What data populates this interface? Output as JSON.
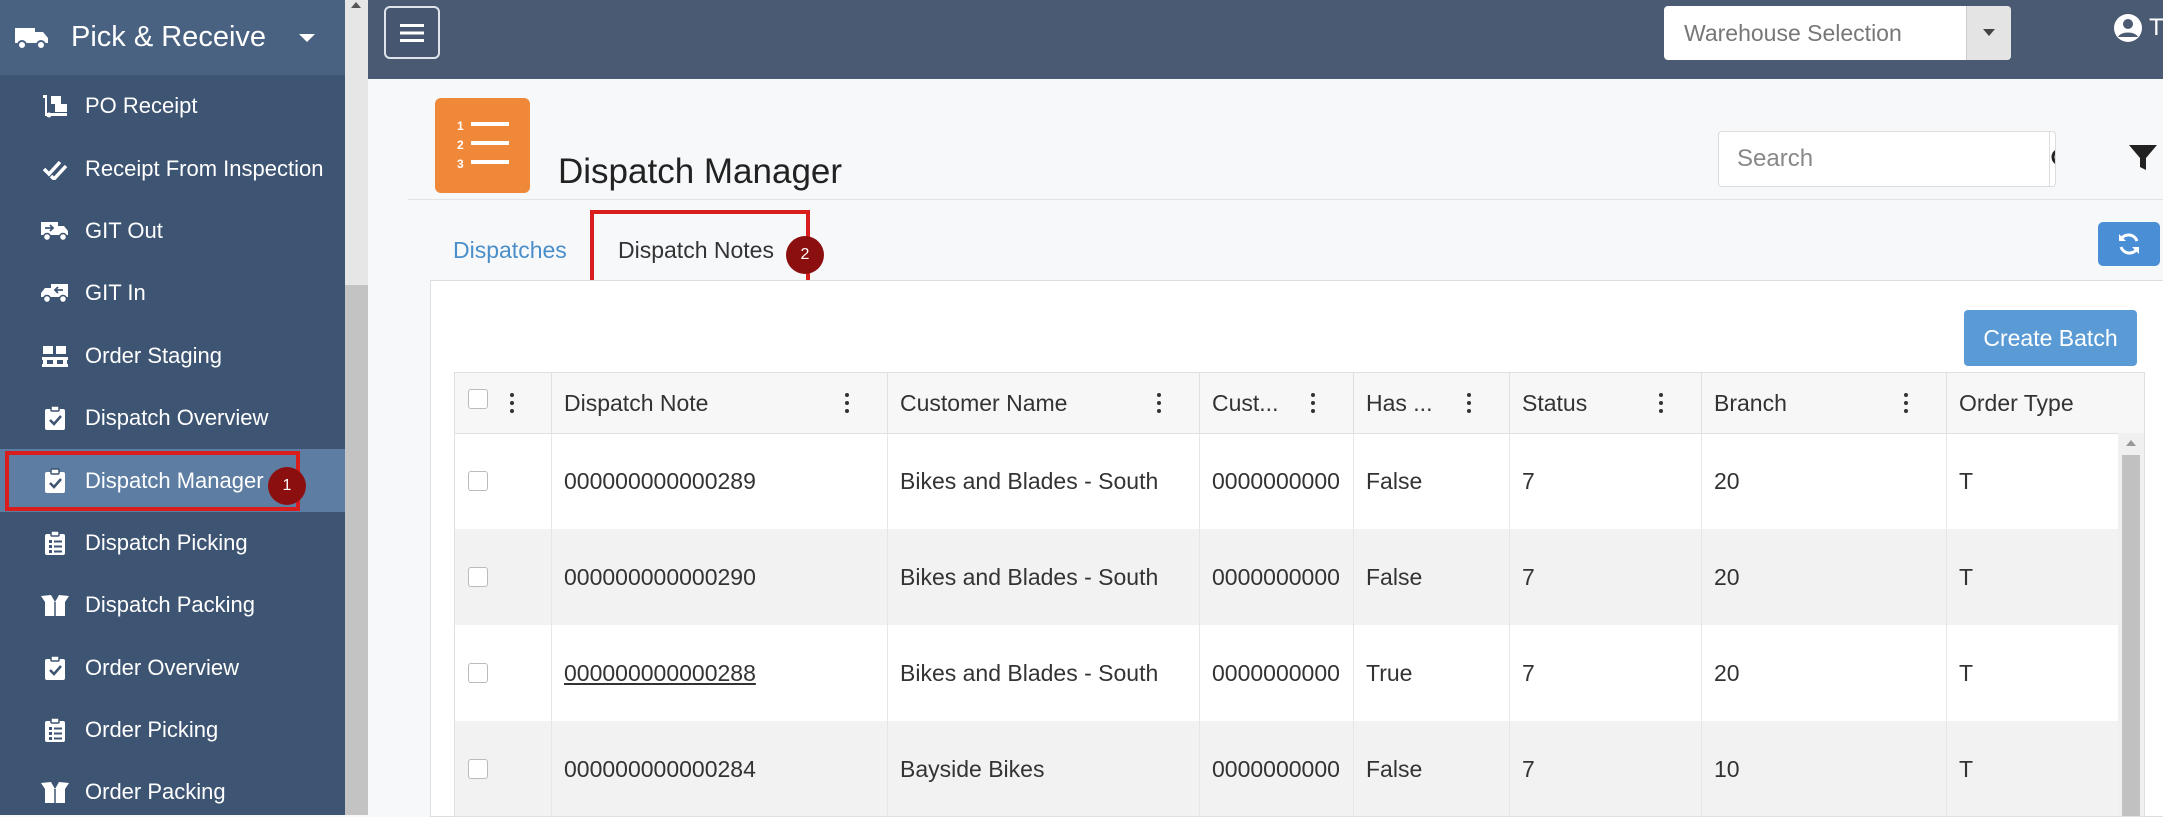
{
  "sidebar": {
    "header": "Pick & Receive",
    "items": [
      {
        "label": "PO Receipt",
        "icon": "dolly-icon"
      },
      {
        "label": "Receipt From Inspection",
        "icon": "double-check-icon"
      },
      {
        "label": "GIT Out",
        "icon": "truck-out-icon"
      },
      {
        "label": "GIT In",
        "icon": "truck-in-icon"
      },
      {
        "label": "Order Staging",
        "icon": "pallet-icon"
      },
      {
        "label": "Dispatch Overview",
        "icon": "clipboard-check-icon"
      },
      {
        "label": "Dispatch Manager",
        "icon": "clipboard-check-icon",
        "active": true,
        "badge": "1"
      },
      {
        "label": "Dispatch Picking",
        "icon": "clipboard-list-icon"
      },
      {
        "label": "Dispatch Packing",
        "icon": "box-open-icon"
      },
      {
        "label": "Order Overview",
        "icon": "clipboard-check-icon"
      },
      {
        "label": "Order Picking",
        "icon": "clipboard-list-icon"
      },
      {
        "label": "Order Packing",
        "icon": "box-open-icon"
      }
    ]
  },
  "topbar": {
    "warehouse_placeholder": "Warehouse Selection",
    "user_initial": "T"
  },
  "page": {
    "title": "Dispatch Manager",
    "search_placeholder": "Search",
    "tabs": [
      {
        "label": "Dispatches",
        "active": false
      },
      {
        "label": "Dispatch Notes",
        "active": true,
        "badge": "2"
      }
    ],
    "create_batch_label": "Create Batch"
  },
  "grid": {
    "columns": [
      "Dispatch Note",
      "Customer Name",
      "Cust...",
      "Has ...",
      "Status",
      "Branch",
      "Order Type"
    ],
    "rows": [
      {
        "dispatch_note": "000000000000289",
        "customer_name": "Bikes and Blades - South",
        "cust": "0000000000",
        "has": "False",
        "status": "7",
        "branch": "20",
        "order_type": "T",
        "link": false
      },
      {
        "dispatch_note": "000000000000290",
        "customer_name": "Bikes and Blades - South",
        "cust": "0000000000",
        "has": "False",
        "status": "7",
        "branch": "20",
        "order_type": "T",
        "link": false
      },
      {
        "dispatch_note": "000000000000288",
        "customer_name": "Bikes and Blades - South",
        "cust": "0000000000",
        "has": "True",
        "status": "7",
        "branch": "20",
        "order_type": "T",
        "link": true
      },
      {
        "dispatch_note": "000000000000284",
        "customer_name": "Bayside Bikes",
        "cust": "0000000000",
        "has": "False",
        "status": "7",
        "branch": "10",
        "order_type": "T",
        "link": false
      }
    ]
  },
  "colors": {
    "sidebar_bg": "#3d5472",
    "active_item": "#5d7da3",
    "topbar_bg": "#4a5a73",
    "accent_orange": "#f0883a",
    "accent_blue": "#5b9bd5",
    "highlight_red": "#d91c1c"
  }
}
